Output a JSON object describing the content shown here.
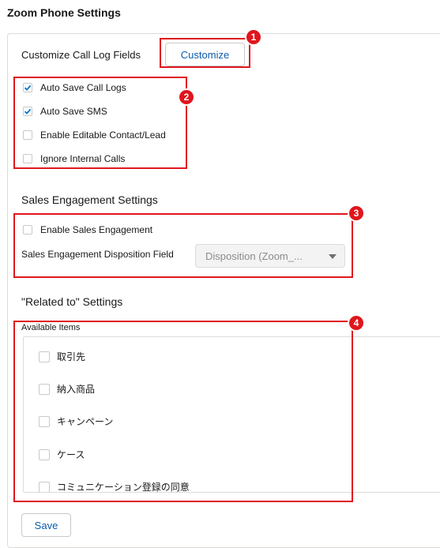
{
  "page": {
    "title": "Zoom Phone Settings"
  },
  "call_log": {
    "label": "Customize Call Log Fields",
    "customize_button": "Customize",
    "checkboxes": [
      {
        "label": "Auto Save Call Logs",
        "checked": true
      },
      {
        "label": "Auto Save SMS",
        "checked": true
      },
      {
        "label": "Enable Editable Contact/Lead",
        "checked": false
      },
      {
        "label": "Ignore Internal Calls",
        "checked": false
      }
    ]
  },
  "sales_engagement": {
    "title": "Sales Engagement Settings",
    "enable_label": "Enable Sales Engagement",
    "enable_checked": false,
    "disposition_label": "Sales Engagement Disposition Field",
    "disposition_value": "Disposition (Zoom_..."
  },
  "related_to": {
    "title": "\"Related to\" Settings",
    "available_label": "Available Items",
    "items": [
      {
        "label": "取引先",
        "checked": false
      },
      {
        "label": "納入商品",
        "checked": false
      },
      {
        "label": "キャンペーン",
        "checked": false
      },
      {
        "label": "ケース",
        "checked": false
      },
      {
        "label": "コミュニケーション登録の同意",
        "checked": false
      }
    ]
  },
  "save_button": "Save",
  "annotations": {
    "badge_1": "1",
    "badge_2": "2",
    "badge_3": "3",
    "badge_4": "4",
    "color": "#e0161d"
  },
  "colors": {
    "accent": "#0b5cab",
    "check": "#0176d3",
    "border": "#dddbda"
  }
}
